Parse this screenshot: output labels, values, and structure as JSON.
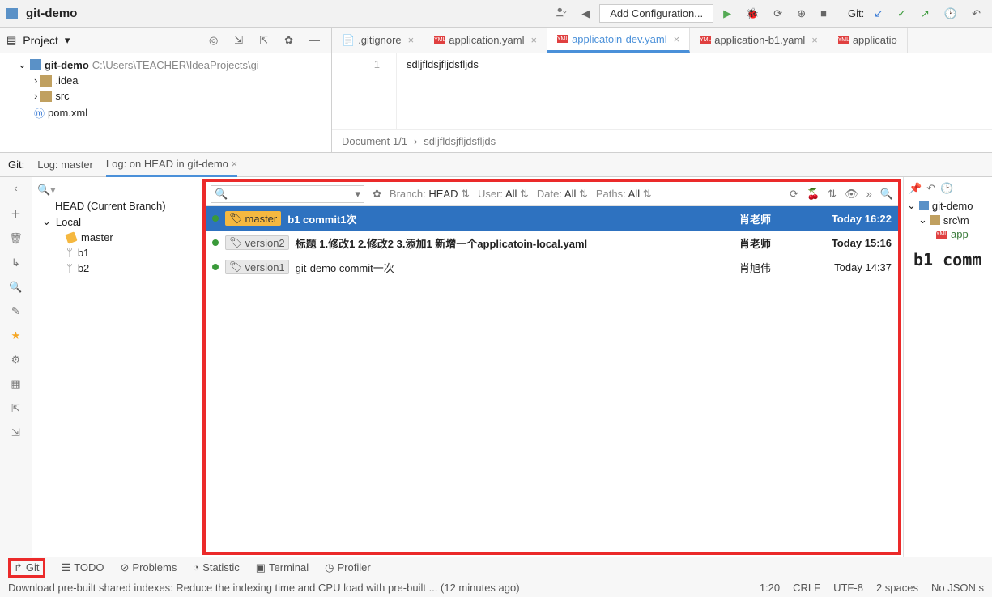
{
  "header": {
    "project_name": "git-demo",
    "add_config": "Add Configuration...",
    "git_label": "Git:"
  },
  "project_pane": {
    "label": "Project",
    "root": "git-demo",
    "root_path": "C:\\Users\\TEACHER\\IdeaProjects\\gi",
    "items": [
      ".idea",
      "src",
      "pom.xml"
    ]
  },
  "editor_tabs": [
    {
      "label": ".gitignore",
      "active": false,
      "type": "file"
    },
    {
      "label": "application.yaml",
      "active": false,
      "type": "yml"
    },
    {
      "label": "applicatoin-dev.yaml",
      "active": true,
      "type": "yml"
    },
    {
      "label": "application-b1.yaml",
      "active": false,
      "type": "yml"
    },
    {
      "label": "applicatio",
      "active": false,
      "type": "yml"
    }
  ],
  "editor": {
    "line_no": "1",
    "content": "sdljfldsjfljdsfljds",
    "breadcrumb_doc": "Document 1/1",
    "breadcrumb_path": "sdljfldsjfljdsfljds"
  },
  "git_tabs": {
    "label": "Git:",
    "t1": "Log: master",
    "t2": "Log: on HEAD in git-demo"
  },
  "branches": {
    "head": "HEAD (Current Branch)",
    "local": "Local",
    "items": [
      "master",
      "b1",
      "b2"
    ]
  },
  "log_filters": {
    "branch_l": "Branch:",
    "branch_v": "HEAD",
    "user_l": "User:",
    "user_v": "All",
    "date_l": "Date:",
    "date_v": "All",
    "paths_l": "Paths:",
    "paths_v": "All"
  },
  "commits": [
    {
      "tags": [
        "master"
      ],
      "message": "b1 commit1次",
      "author": "肖老师",
      "time": "Today 16:22",
      "selected": true,
      "tag_style": "master"
    },
    {
      "tags": [
        "version2"
      ],
      "message": "标题 1.修改1 2.修改2 3.添加1 新增一个applicatoin-local.yaml",
      "author": "肖老师",
      "time": "Today 15:16",
      "selected": false,
      "bold": true
    },
    {
      "tags": [
        "version1"
      ],
      "message": "git-demo commit一次",
      "author": "肖旭伟",
      "time": "Today 14:37",
      "selected": false
    }
  ],
  "changed_files": {
    "root": "git-demo",
    "sub": "src\\m",
    "file": "app"
  },
  "commit_detail_title": "b1 comm",
  "bottom_tabs": [
    "Git",
    "TODO",
    "Problems",
    "Statistic",
    "Terminal",
    "Profiler"
  ],
  "status_bar": {
    "message": "Download pre-built shared indexes: Reduce the indexing time and CPU load with pre-built ... (12 minutes ago)",
    "pos": "1:20",
    "eol": "CRLF",
    "enc": "UTF-8",
    "indent": "2 spaces",
    "lang": "No JSON s"
  }
}
